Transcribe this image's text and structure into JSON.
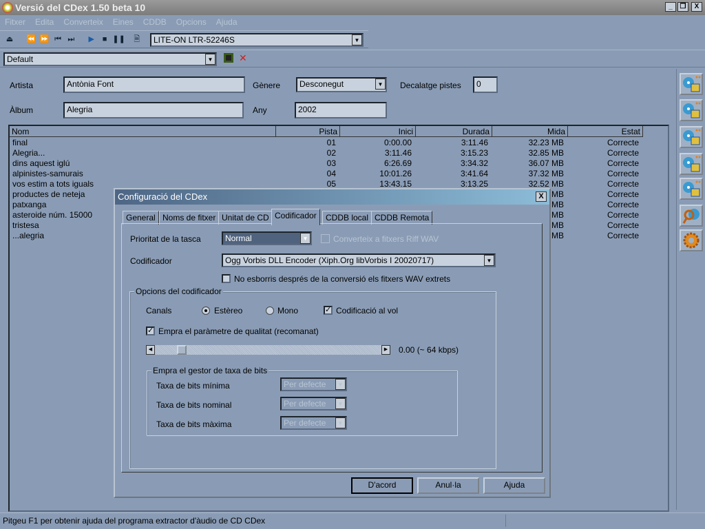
{
  "window": {
    "title": "Versió del CDex 1.50 beta 10",
    "min": "_",
    "restore": "❐",
    "close": "X"
  },
  "menu": [
    "Fitxer",
    "Edita",
    "Converteix",
    "Eines",
    "CDDB",
    "Opcions",
    "Ajuda"
  ],
  "toolbar": {
    "drive": "LITE-ON LTR-52246S",
    "profile": "Default"
  },
  "info": {
    "artist_label": "Artista",
    "artist": "Antònia Font",
    "album_label": "Àlbum",
    "album": "Alegria",
    "genre_label": "Gènere",
    "genre": "Desconegut",
    "year_label": "Any",
    "year": "2002",
    "offset_label": "Decalatge pistes",
    "offset": "0"
  },
  "list": {
    "columns": [
      "Nom",
      "Pista",
      "Inici",
      "Durada",
      "Mida",
      "Estat"
    ],
    "rows": [
      [
        "final",
        "01",
        "0:00.00",
        "3:11.46",
        "32.23 MB",
        "Correcte"
      ],
      [
        "Alegria...",
        "02",
        "3:11.46",
        "3:15.23",
        "32.85 MB",
        "Correcte"
      ],
      [
        "dins aquest iglú",
        "03",
        "6:26.69",
        "3:34.32",
        "36.07 MB",
        "Correcte"
      ],
      [
        "alpinistes-samurais",
        "04",
        "10:01.26",
        "3:41.64",
        "37.32 MB",
        "Correcte"
      ],
      [
        "vos estim a tots iguals",
        "05",
        "13:43.15",
        "3:13.25",
        "32.52 MB",
        "Correcte"
      ],
      [
        "productes de neteja",
        "",
        "",
        "",
        "MB",
        "Correcte"
      ],
      [
        "patxanga",
        "",
        "",
        "",
        "MB",
        "Correcte"
      ],
      [
        "asteroide núm. 15000",
        "",
        "",
        "",
        "MB",
        "Correcte"
      ],
      [
        "tristesa",
        "",
        "",
        "",
        "MB",
        "Correcte"
      ],
      [
        "...alegria",
        "",
        "",
        "",
        "MB",
        "Correcte"
      ]
    ]
  },
  "status": "Pitgeu F1 per obtenir ajuda del programa extractor d'àudio de CD CDex",
  "dialog": {
    "title": "Configuració del CDex",
    "close": "X",
    "tabs": [
      "General",
      "Noms de fitxer",
      "Unitat de CD",
      "Codificador",
      "CDDB local",
      "CDDB Remota"
    ],
    "priority_label": "Prioritat de la tasca",
    "priority": "Normal",
    "riff_label": "Converteix a fitxers Riff WAV",
    "encoder_label": "Codificador",
    "encoder": "Ogg Vorbis DLL Encoder (Xiph.Org libVorbis I 20020717)",
    "keep_wav_label": "No esborris després de la conversió els fitxers WAV extrets",
    "options_group": "Opcions del codificador",
    "channels_label": "Canals",
    "stereo": "Estèreo",
    "mono": "Mono",
    "vbr": "Codificació al vol",
    "quality_label": "Empra el paràmetre de qualitat (recomanat)",
    "quality_value": "0.00 (~ 64 kbps)",
    "quality_slider_fraction": 0.1,
    "bitrate_group": "Empra el gestor de taxa de bits",
    "min_label": "Taxa de bits mínima",
    "nom_label": "Taxa de bits nominal",
    "max_label": "Taxa de bits màxima",
    "default_opt": "Per defecte",
    "ok": "D'acord",
    "cancel": "Anul·la",
    "help": "Ajuda"
  }
}
